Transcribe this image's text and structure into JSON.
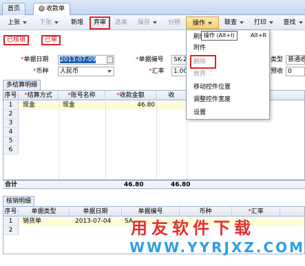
{
  "tabs": [
    {
      "label": "首页"
    },
    {
      "label": "收款单"
    }
  ],
  "toolbar": {
    "prev": "上张",
    "next": "下张",
    "add": "新增",
    "abandon_audit": "弃审",
    "select": "选单",
    "save": "保存",
    "split": "分辨",
    "operate": "操作",
    "linked_query": "联查",
    "print": "打印",
    "find": "查找"
  },
  "actions": {
    "verify": "已核销",
    "audited": "已审"
  },
  "form": {
    "date_label": "单据日期",
    "date_value": "2013-07-09",
    "billno_label": "单据编号",
    "billno_value": "SK-2",
    "currency_label": "币种",
    "currency_value": "人民币",
    "rate_label": "汇率",
    "rate_value": "1.00",
    "type_label": "类型",
    "type_value": "普通收",
    "advance_label": "预收",
    "advance_value": "0"
  },
  "settle_section": {
    "title": "多结算明细",
    "columns": [
      "序号",
      "结算方式",
      "账号名称",
      "收款金额",
      "收"
    ],
    "rows": [
      {
        "no": "1",
        "method": "现金",
        "account": "现金",
        "amount": "46.80"
      },
      {
        "no": "2"
      },
      {
        "no": "3"
      },
      {
        "no": "4"
      },
      {
        "no": "5"
      },
      {
        "no": "6"
      }
    ],
    "total_label": "合计",
    "total_amount": "46.80",
    "total_amount2": "46.80"
  },
  "verify_section": {
    "title": "核销明细",
    "columns": [
      "序号",
      "单据类型",
      "单据日期",
      "单据编号",
      "币种",
      "汇率"
    ],
    "rows": [
      {
        "no": "1",
        "type": "销货单",
        "date": "2013-07-04",
        "billno": "SA"
      },
      {
        "no": "2"
      }
    ]
  },
  "operate_menu": {
    "items": [
      "刷新",
      "附件",
      "删除",
      "放弃",
      "移动控件位置",
      "调整控件宽度",
      "设置"
    ],
    "tooltip": "操作 (Alt+I)",
    "accel": "Alt+R"
  },
  "watermark": {
    "line1": "用友软件下载",
    "line2": "WWW.YYRJXZ.COM"
  },
  "colors": {
    "accent_red": "#e0202a",
    "selection_blue": "#1f5fb4",
    "highlight_row": "#fefbd8"
  }
}
